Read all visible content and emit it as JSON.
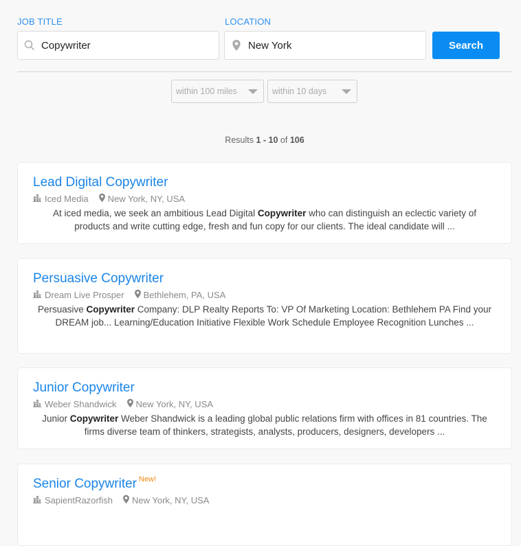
{
  "search": {
    "job_title_label": "JOB TITLE",
    "job_title_value": "Copywriter",
    "location_label": "LOCATION",
    "location_value": "New York",
    "search_button": "Search",
    "icons": {
      "job": "search-icon",
      "location": "map-pin-icon"
    }
  },
  "filters": {
    "distance": {
      "selected": "within 100 miles"
    },
    "age": {
      "selected": "within 10 days"
    }
  },
  "results": {
    "prefix": "Results",
    "range": "1 - 10",
    "of_word": "of",
    "total": "106"
  },
  "colors": {
    "accent": "#1a85e8",
    "button": "#0a8cf2",
    "new_badge": "#f08a13"
  },
  "jobs": [
    {
      "title": "Lead Digital Copywriter",
      "new": "",
      "company": "Iced Media",
      "location": "New York, NY, USA",
      "desc_before": "At iced media, we seek an ambitious Lead Digital ",
      "desc_highlight": "Copywriter",
      "desc_after": " who can distinguish an eclectic variety of products and write cutting edge, fresh and fun copy for our clients. The ideal candidate will ..."
    },
    {
      "title": "Persuasive Copywriter",
      "new": "",
      "company": "Dream Live Prosper",
      "location": "Bethlehem, PA, USA",
      "desc_before": "Persuasive ",
      "desc_highlight": "Copywriter",
      "desc_after": " Company: DLP Realty Reports To: VP Of Marketing Location: Bethlehem PA Find your DREAM job... Learning/Education Initiative Flexible Work Schedule Employee Recognition Lunches ..."
    },
    {
      "title": "Junior Copywriter",
      "new": "",
      "company": "Weber Shandwick",
      "location": "New York, NY, USA",
      "desc_before": "Junior ",
      "desc_highlight": "Copywriter",
      "desc_after": " Weber Shandwick is a leading global public relations firm with offices in 81 countries. The firms diverse team of thinkers, strategists, analysts, producers, designers, developers ..."
    },
    {
      "title": "Senior Copywriter",
      "new": "New!",
      "company": "SapientRazorfish",
      "location": "New York, NY, USA",
      "desc_before": "",
      "desc_highlight": "",
      "desc_after": ""
    }
  ]
}
